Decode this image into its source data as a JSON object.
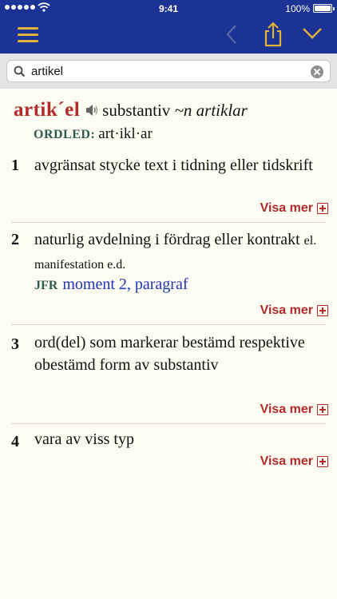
{
  "status": {
    "time": "9:41",
    "battery": "100%"
  },
  "search": {
    "value": "artikel"
  },
  "entry": {
    "headword": "artik´el",
    "pos": "substantiv",
    "inflection": "~n artiklar",
    "ordled_label": "ORDLED:",
    "ordled": "art·ikl·ar"
  },
  "senses": [
    {
      "num": "1",
      "text": "avgränsat stycke text i tidning eller tidskrift",
      "more": "Visa mer"
    },
    {
      "num": "2",
      "text": "naturlig avdelning i fördrag eller kontrakt",
      "note": "el. manifestation e.d.",
      "jfr_label": "JFR",
      "jfr": "moment 2, paragraf",
      "more": "Visa mer"
    },
    {
      "num": "3",
      "text": "ord(del) som markerar bestämd respektive obestämd form av substantiv",
      "more": "Visa mer"
    },
    {
      "num": "4",
      "text": "vara av viss typ",
      "more": "Visa mer"
    }
  ],
  "colors": {
    "header": "#1a3394",
    "accent": "#e2b23a",
    "headword": "#b22a2a",
    "link": "#2233b8"
  },
  "icons": [
    "menu-icon",
    "back-chevron-icon",
    "share-icon",
    "chevron-down-icon",
    "search-icon",
    "clear-icon",
    "speaker-icon",
    "plus-box-icon"
  ]
}
